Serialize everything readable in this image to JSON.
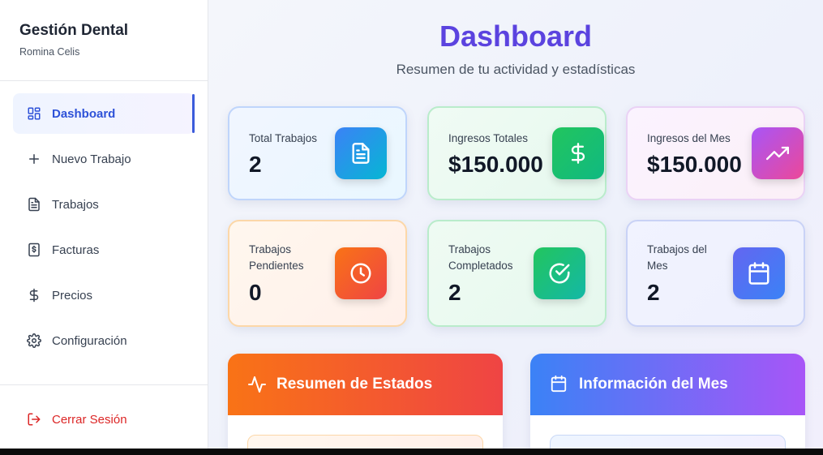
{
  "sidebar": {
    "brand_title": "Gestión Dental",
    "user_name": "Romina Celis",
    "items": [
      {
        "label": "Dashboard",
        "icon": "dashboard-grid-icon",
        "active": true
      },
      {
        "label": "Nuevo Trabajo",
        "icon": "plus-icon"
      },
      {
        "label": "Trabajos",
        "icon": "document-icon"
      },
      {
        "label": "Facturas",
        "icon": "invoice-dollar-icon"
      },
      {
        "label": "Precios",
        "icon": "dollar-icon"
      },
      {
        "label": "Configuración",
        "icon": "gear-icon"
      }
    ],
    "logout_label": "Cerrar Sesión"
  },
  "header": {
    "title": "Dashboard",
    "subtitle": "Resumen de tu actividad y estadísticas"
  },
  "stats": [
    {
      "label": "Total Trabajos",
      "value": "2",
      "icon": "file-text-icon"
    },
    {
      "label": "Ingresos Totales",
      "value": "$150.000",
      "icon": "dollar-icon"
    },
    {
      "label": "Ingresos del Mes",
      "value": "$150.000",
      "icon": "trending-up-icon"
    },
    {
      "label": "Trabajos Pendientes",
      "value": "0",
      "icon": "clock-icon"
    },
    {
      "label": "Trabajos Completados",
      "value": "2",
      "icon": "check-circle-icon"
    },
    {
      "label": "Trabajos del Mes",
      "value": "2",
      "icon": "calendar-icon"
    }
  ],
  "panels": [
    {
      "title": "Resumen de Estados",
      "icon": "activity-icon"
    },
    {
      "title": "Información del Mes",
      "icon": "calendar-icon"
    }
  ],
  "colors": {
    "accent": "#5b43df",
    "active_nav": "#2e52d8",
    "logout": "#dc2626"
  }
}
